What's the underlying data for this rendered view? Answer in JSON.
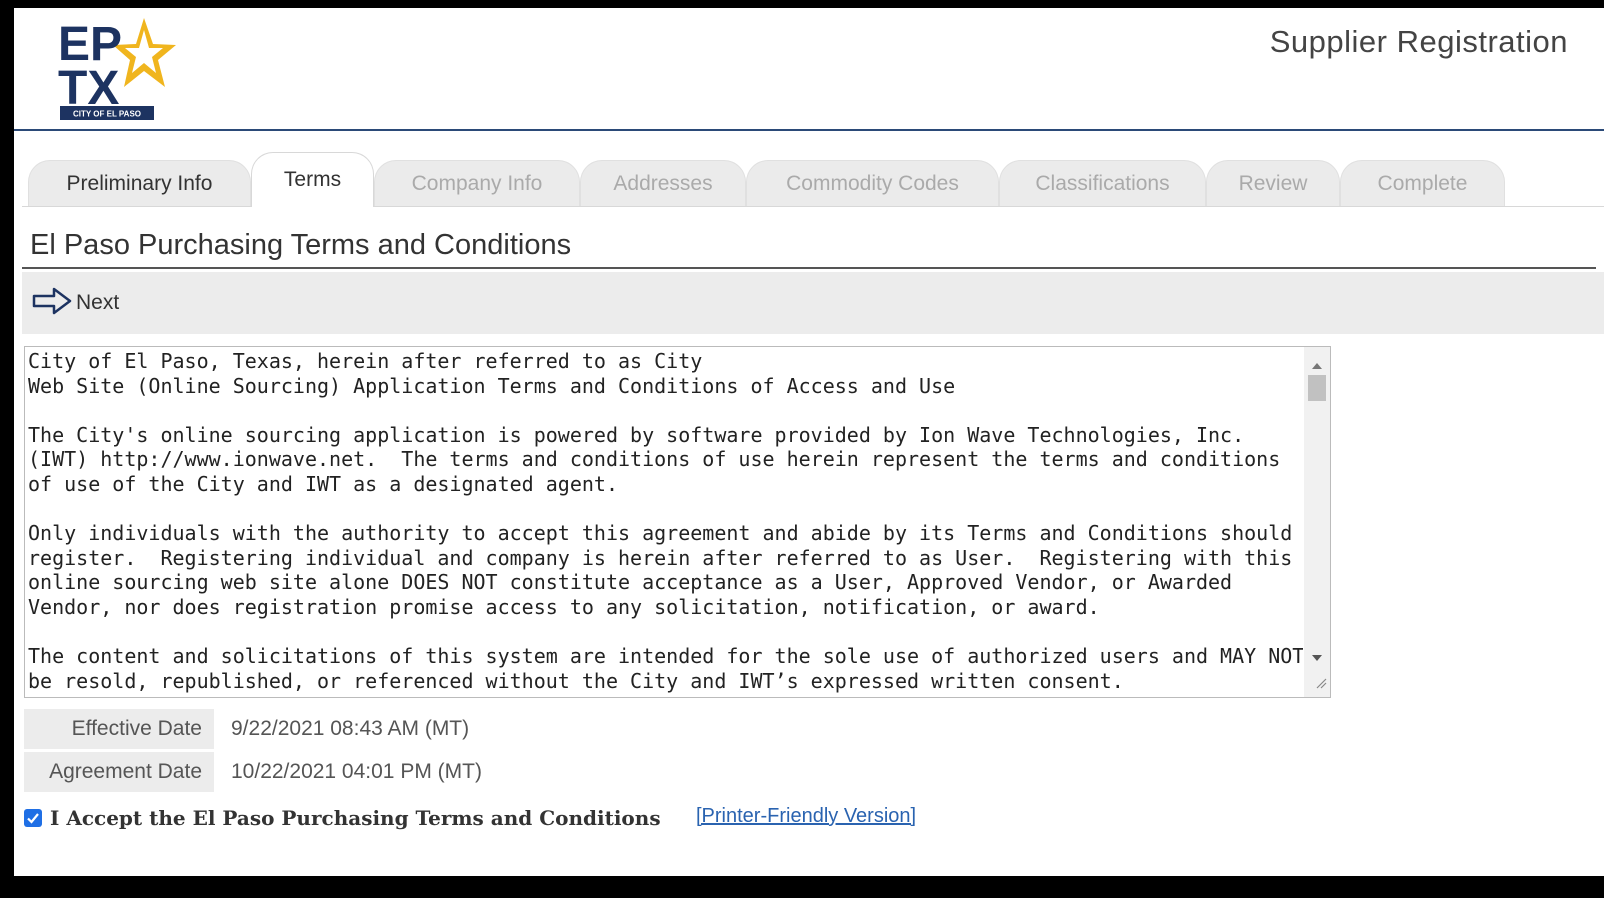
{
  "header": {
    "logo_text_top": "EP",
    "logo_text_bottom": "TX",
    "logo_subtitle": "CITY OF EL PASO",
    "title": "Supplier Registration"
  },
  "tabs": [
    {
      "label": "Preliminary Info",
      "state": "done"
    },
    {
      "label": "Terms",
      "state": "active"
    },
    {
      "label": "Company Info",
      "state": "disabled"
    },
    {
      "label": "Addresses",
      "state": "disabled"
    },
    {
      "label": "Commodity Codes",
      "state": "disabled"
    },
    {
      "label": "Classifications",
      "state": "disabled"
    },
    {
      "label": "Review",
      "state": "disabled"
    },
    {
      "label": "Complete",
      "state": "disabled"
    }
  ],
  "terms": {
    "heading": "El Paso Purchasing Terms and Conditions",
    "next_label": "Next",
    "body_lines": [
      "City of El Paso, Texas, herein after referred to as City",
      "Web Site (Online Sourcing) Application Terms and Conditions of Access and Use",
      "",
      "The City's online sourcing application is powered by software provided by Ion Wave Technologies, Inc.",
      "(IWT) http://www.ionwave.net.  The terms and conditions of use herein represent the terms and conditions",
      "of use of the City and IWT as a designated agent.",
      "",
      "Only individuals with the authority to accept this agreement and abide by its Terms and Conditions should",
      "register.  Registering individual and company is herein after referred to as User.  Registering with this",
      "online sourcing web site alone DOES NOT constitute acceptance as a User, Approved Vendor, or Awarded",
      "Vendor, nor does registration promise access to any solicitation, notification, or award.",
      "",
      "The content and solicitations of this system are intended for the sole use of authorized users and MAY NOT",
      "be resold, republished, or referenced without the City and IWT’s expressed written consent."
    ]
  },
  "dates": {
    "effective_label": "Effective Date",
    "effective_value": "9/22/2021 08:43 AM (MT)",
    "agreement_label": "Agreement Date",
    "agreement_value": "10/22/2021 04:01 PM (MT)"
  },
  "accept": {
    "checked": true,
    "label": "I Accept the El Paso Purchasing Terms and Conditions",
    "printer_link": "[Printer-Friendly Version]"
  },
  "colors": {
    "logo_navy": "#1d3361",
    "logo_gold": "#f0b51e",
    "header_rule": "#2b4a78",
    "link": "#2a63b0",
    "checkbox": "#1f6fe5"
  }
}
